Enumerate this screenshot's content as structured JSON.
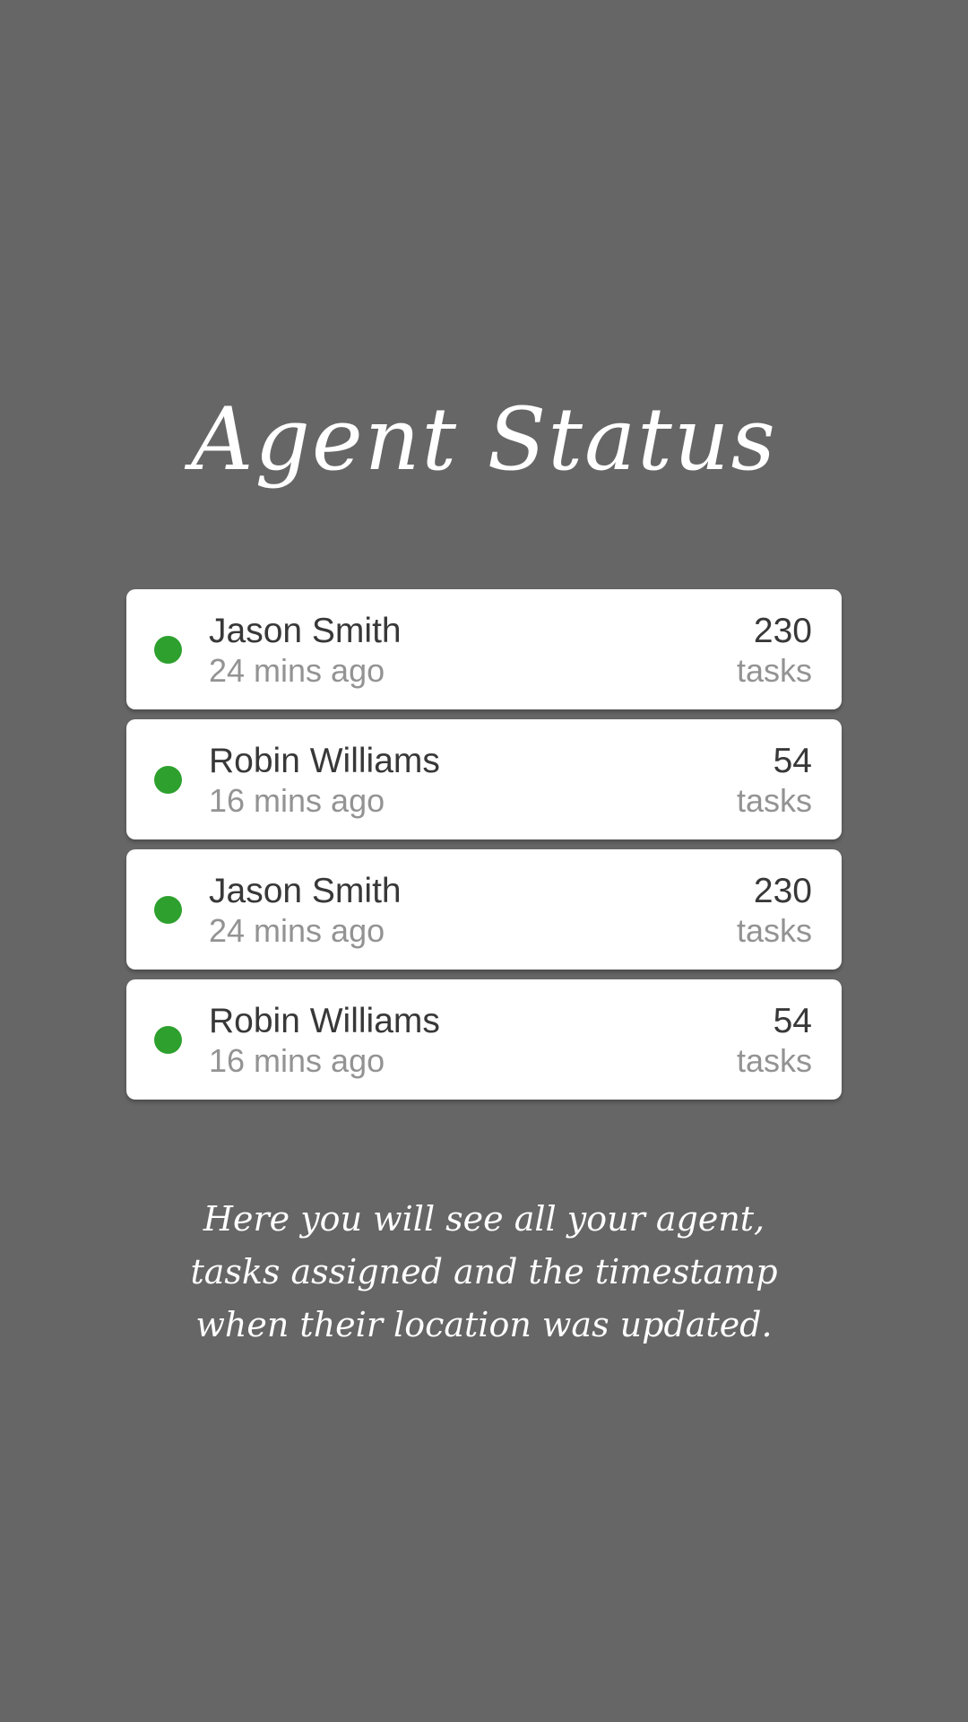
{
  "title": "Agent Status",
  "status_color": "#2ea02e",
  "agents": [
    {
      "name": "Jason Smith",
      "last_update": "24 mins ago",
      "task_count": "230",
      "task_label": "tasks",
      "status": "online"
    },
    {
      "name": "Robin Williams",
      "last_update": "16 mins ago",
      "task_count": "54",
      "task_label": "tasks",
      "status": "online"
    },
    {
      "name": "Jason Smith",
      "last_update": "24 mins ago",
      "task_count": "230",
      "task_label": "tasks",
      "status": "online"
    },
    {
      "name": "Robin Williams",
      "last_update": "16 mins ago",
      "task_count": "54",
      "task_label": "tasks",
      "status": "online"
    }
  ],
  "description": "Here you will see all your agent, tasks assigned and the timestamp when their location was updated."
}
